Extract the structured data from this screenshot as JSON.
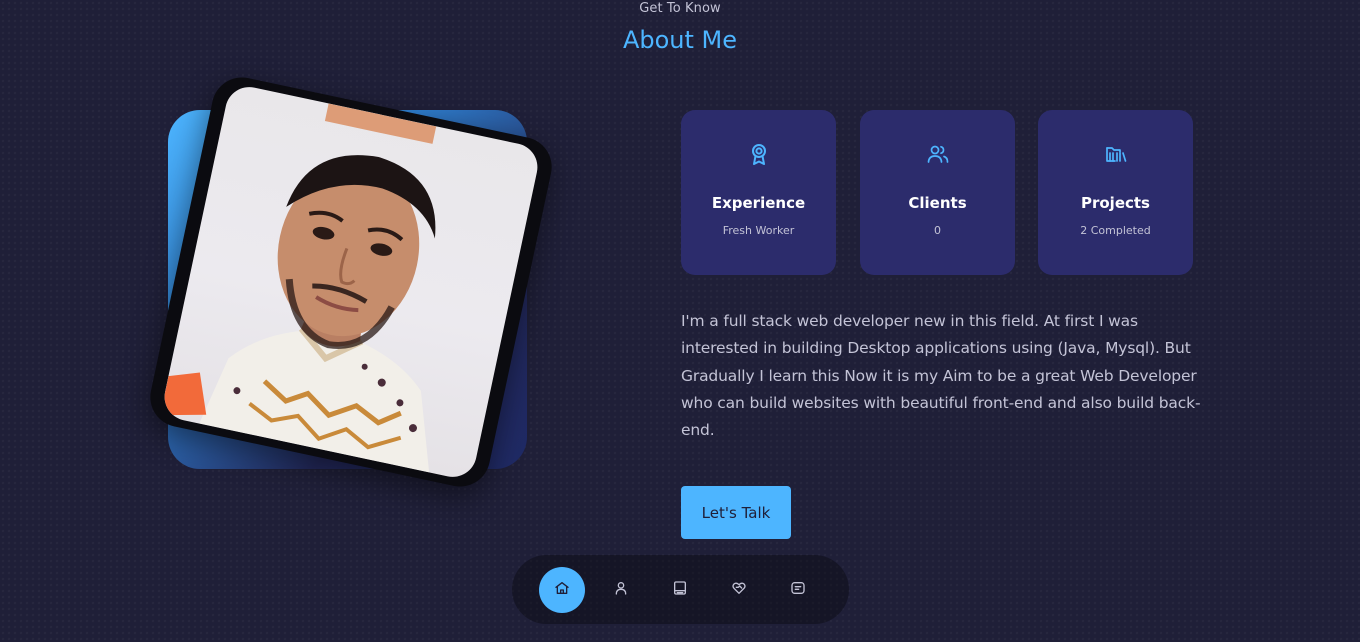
{
  "header": {
    "subtitle": "Get To Know",
    "title": "About Me"
  },
  "cards": [
    {
      "title": "Experience",
      "value": "Fresh Worker",
      "icon": "award-icon"
    },
    {
      "title": "Clients",
      "value": "0",
      "icon": "users-icon"
    },
    {
      "title": "Projects",
      "value": "2 Completed",
      "icon": "folder-library-icon"
    }
  ],
  "about": {
    "text": "I'm a full stack web developer new in this field. At first I was interested in building Desktop applications using (Java, Mysql). But Gradually I learn this Now it is my Aim to be a great Web Developer who can build websites with beautiful front-end and also build back-end."
  },
  "cta": {
    "label": "Let's Talk"
  },
  "nav": {
    "items": [
      {
        "icon": "home-icon",
        "active": true
      },
      {
        "icon": "user-icon",
        "active": false
      },
      {
        "icon": "book-icon",
        "active": false
      },
      {
        "icon": "service-heart-icon",
        "active": false
      },
      {
        "icon": "message-icon",
        "active": false
      }
    ]
  },
  "colors": {
    "background": "#1f1f38",
    "primary": "#4db5ff",
    "card": "#2c2c6c",
    "text_muted": "#c3c3d6"
  }
}
